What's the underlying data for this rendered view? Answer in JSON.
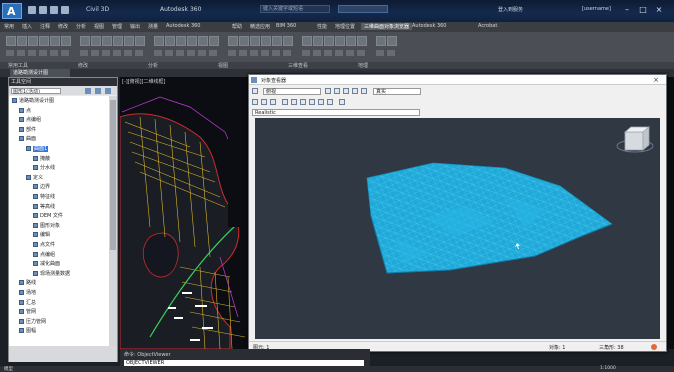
{
  "title": {
    "filename": "Civil 3D",
    "app": "Autodesk 360",
    "search_placeholder": "键入关键字或短语",
    "user": "[username]"
  },
  "ribbon_tabs": [
    "常用",
    "插入",
    "注释",
    "修改",
    "分析",
    "视图",
    "管理",
    "输出",
    "测量",
    "Autodesk 360",
    "帮助",
    "精选应用",
    "BIM 360",
    "性能",
    "地理位置",
    "三维曲面对象浏览器",
    "Autodesk 360",
    "Acrobat"
  ],
  "panel_labels": [
    "常用工具",
    "修改",
    "分析",
    "视图",
    "三维查看",
    "地理"
  ],
  "doc_tab": "道路勘测设计图",
  "toolspace": {
    "header": "工具空间",
    "select": "图形1(活动)",
    "tree": [
      {
        "label": "道路勘测设计图",
        "indent": 0
      },
      {
        "label": "点",
        "indent": 1
      },
      {
        "label": "点编组",
        "indent": 1
      },
      {
        "label": "部件",
        "indent": 1
      },
      {
        "label": "曲面",
        "indent": 1
      },
      {
        "label": "曲面1",
        "indent": 2,
        "selected": true
      },
      {
        "label": "掩蔽",
        "indent": 3
      },
      {
        "label": "分水线",
        "indent": 3
      },
      {
        "label": "定义",
        "indent": 2
      },
      {
        "label": "边界",
        "indent": 3
      },
      {
        "label": "特征线",
        "indent": 3
      },
      {
        "label": "等高线",
        "indent": 3
      },
      {
        "label": "DEM 文件",
        "indent": 3
      },
      {
        "label": "图形对象",
        "indent": 3
      },
      {
        "label": "编辑",
        "indent": 3
      },
      {
        "label": "点文件",
        "indent": 3
      },
      {
        "label": "点编组",
        "indent": 3
      },
      {
        "label": "减化曲面",
        "indent": 3
      },
      {
        "label": "现场测量数据",
        "indent": 3
      },
      {
        "label": "路线",
        "indent": 1
      },
      {
        "label": "场地",
        "indent": 1
      },
      {
        "label": "汇总",
        "indent": 1
      },
      {
        "label": "管网",
        "indent": 1
      },
      {
        "label": "压力管网",
        "indent": 1
      },
      {
        "label": "图幅",
        "indent": 1
      }
    ]
  },
  "map": {
    "viewport_label": "[-][俯视][二维线框]"
  },
  "viewer": {
    "title": "对象查看器",
    "view_combo": "俯视",
    "style_combo": "真实",
    "visual_combo": "Realistic",
    "status_left": "图元: 1",
    "status_mid": "对象: 1",
    "status_right": "三角形: 38"
  },
  "command": {
    "history": "命令: ObjectViewer",
    "input": "OBJECTVIEWER"
  },
  "status": {
    "model": "模型",
    "coords": "1:1000"
  },
  "colors": {
    "surface": "#1fa9d9",
    "viewer_bg": "#303844",
    "map_bg": "#0b0d12"
  }
}
